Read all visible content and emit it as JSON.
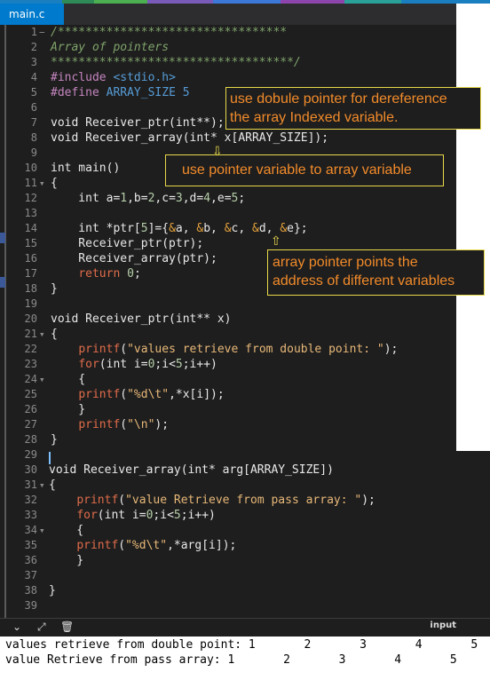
{
  "colors": {
    "editor_bg": "#1e1e1e",
    "tab_active": "#007acc",
    "annotation_text": "#f28b2a",
    "annotation_border": "#e8d84a"
  },
  "tab": {
    "label": "main.c"
  },
  "code_lines": [
    {
      "n": "1",
      "fold": "−",
      "html": "<span class='cmt'>/*********************************</span>"
    },
    {
      "n": "2",
      "fold": "",
      "html": "<span class='cmt'>Array of pointers</span>"
    },
    {
      "n": "3",
      "fold": "",
      "html": "<span class='cmt'>***********************************/</span>"
    },
    {
      "n": "4",
      "fold": "",
      "html": "<span class='pp'>#include</span> <span class='hdr'>&lt;stdio.h&gt;</span>"
    },
    {
      "n": "5",
      "fold": "",
      "html": "<span class='pp'>#define</span> <span class='hdr'>ARRAY_SIZE 5</span>"
    },
    {
      "n": "6",
      "fold": "",
      "html": ""
    },
    {
      "n": "7",
      "fold": "",
      "html": "void Receiver_ptr(int**);"
    },
    {
      "n": "8",
      "fold": "",
      "html": "void Receiver_array(int* x[ARRAY_SIZE]);"
    },
    {
      "n": "9",
      "fold": "",
      "html": ""
    },
    {
      "n": "10",
      "fold": "",
      "html": "int main()"
    },
    {
      "n": "11",
      "fold": "▾",
      "html": "{"
    },
    {
      "n": "12",
      "fold": "",
      "html": "    int a=<span class='num'>1</span>,b=<span class='num'>2</span>,c=<span class='num'>3</span>,d=<span class='num'>4</span>,e=<span class='num'>5</span>;"
    },
    {
      "n": "13",
      "fold": "",
      "html": ""
    },
    {
      "n": "14",
      "fold": "",
      "html": "    int *ptr[<span class='num'>5</span>]={<span class='amp'>&amp;</span>a, <span class='amp'>&amp;</span>b, <span class='amp'>&amp;</span>c, <span class='amp'>&amp;</span>d, <span class='amp'>&amp;</span>e};"
    },
    {
      "n": "15",
      "fold": "",
      "html": "    Receiver_ptr(ptr);"
    },
    {
      "n": "16",
      "fold": "",
      "html": "    Receiver_array(ptr);"
    },
    {
      "n": "17",
      "fold": "",
      "html": "    <span class='ret'>return</span> <span class='num'>0</span>;"
    },
    {
      "n": "18",
      "fold": "",
      "html": "}"
    },
    {
      "n": "19",
      "fold": "",
      "html": ""
    },
    {
      "n": "20",
      "fold": "",
      "html": "void Receiver_ptr(int** x)"
    },
    {
      "n": "21",
      "fold": "▾",
      "html": "{"
    },
    {
      "n": "22",
      "fold": "",
      "html": "    <span class='fn'>printf</span>(<span class='str'>\"values retrieve from double point: \"</span>);"
    },
    {
      "n": "23",
      "fold": "",
      "html": "    <span class='fn'>for</span>(int i=<span class='num'>0</span>;i&lt;<span class='num'>5</span>;i++)"
    },
    {
      "n": "24",
      "fold": "▾",
      "html": "    {"
    },
    {
      "n": "25",
      "fold": "",
      "html": "    <span class='fn'>printf</span>(<span class='str'>\"%d\\t\"</span>,*x[i]);"
    },
    {
      "n": "26",
      "fold": "",
      "html": "    }"
    },
    {
      "n": "27",
      "fold": "",
      "html": "    <span class='fn'>printf</span>(<span class='str'>\"\\n\"</span>);"
    },
    {
      "n": "28",
      "fold": "",
      "html": "}"
    },
    {
      "n": "29",
      "fold": "",
      "html": ""
    },
    {
      "n": "30",
      "fold": "",
      "html": "void Receiver_array(int* arg[ARRAY_SIZE])"
    },
    {
      "n": "31",
      "fold": "▾",
      "html": "{"
    },
    {
      "n": "32",
      "fold": "",
      "html": "    <span class='fn'>printf</span>(<span class='str'>\"value Retrieve from pass array: \"</span>);"
    },
    {
      "n": "33",
      "fold": "",
      "html": "    <span class='fn'>for</span>(int i=<span class='num'>0</span>;i&lt;<span class='num'>5</span>;i++)"
    },
    {
      "n": "34",
      "fold": "▾",
      "html": "    {"
    },
    {
      "n": "35",
      "fold": "",
      "html": "    <span class='fn'>printf</span>(<span class='str'>\"%d\\t\"</span>,*arg[i]);"
    },
    {
      "n": "36",
      "fold": "",
      "html": "    }"
    },
    {
      "n": "37",
      "fold": "",
      "html": ""
    },
    {
      "n": "38",
      "fold": "",
      "html": "}"
    },
    {
      "n": "39",
      "fold": "",
      "html": ""
    }
  ],
  "annotations": {
    "double_pointer": {
      "line1": "use dobule pointer for dereference",
      "line2": "the array Indexed variable."
    },
    "pointer_variable": {
      "line1": "use pointer variable to array variable"
    },
    "array_pointer": {
      "line1": "array pointer points the",
      "line2": "address of different variables"
    }
  },
  "toolbar": {
    "input_label": "input"
  },
  "output": {
    "line1": "values retrieve from double point: 1       2       3       4       5",
    "line2": "value Retrieve from pass array: 1       2       3       4       5"
  }
}
